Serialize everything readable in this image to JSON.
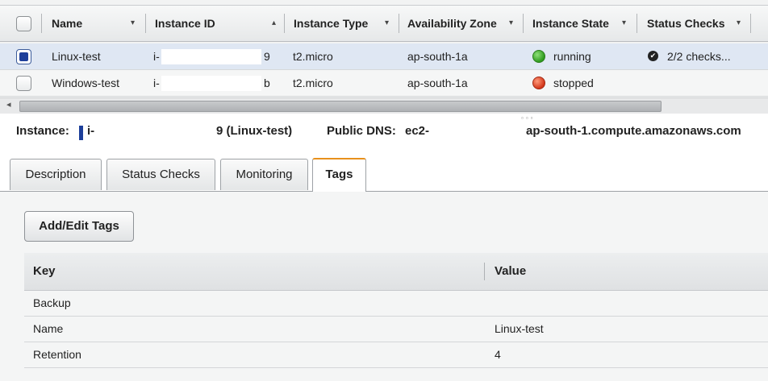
{
  "table": {
    "columns": [
      {
        "label": "Name",
        "caret": "▾"
      },
      {
        "label": "Instance ID",
        "caret": "▴"
      },
      {
        "label": "Instance Type",
        "caret": "▾"
      },
      {
        "label": "Availability Zone",
        "caret": "▾"
      },
      {
        "label": "Instance State",
        "caret": "▾"
      },
      {
        "label": "Status Checks",
        "caret": "▾"
      }
    ],
    "rows": [
      {
        "selected": true,
        "name": "Linux-test",
        "id_prefix": "i-",
        "id_suffix": "9",
        "type": "t2.micro",
        "az": "ap-south-1a",
        "state": "running",
        "state_color": "#3aa52a",
        "checks": "2/2 checks..."
      },
      {
        "selected": false,
        "name": "Windows-test",
        "id_prefix": "i-",
        "id_suffix": "b",
        "type": "t2.micro",
        "az": "ap-south-1a",
        "state": "stopped",
        "state_color": "#d9341c",
        "checks": ""
      }
    ]
  },
  "instance_info": {
    "instance_label": "Instance:",
    "instance_prefix": "i-",
    "instance_suffix": "9 (Linux-test)",
    "dns_label": "Public DNS:",
    "dns_prefix": "ec2-",
    "dns_suffix": "ap-south-1.compute.amazonaws.com"
  },
  "tabs": [
    {
      "label": "Description",
      "active": false
    },
    {
      "label": "Status Checks",
      "active": false
    },
    {
      "label": "Monitoring",
      "active": false
    },
    {
      "label": "Tags",
      "active": true
    }
  ],
  "tags": {
    "add_edit_label": "Add/Edit Tags",
    "key_header": "Key",
    "value_header": "Value",
    "rows": [
      {
        "key": "Backup",
        "value": ""
      },
      {
        "key": "Name",
        "value": "Linux-test"
      },
      {
        "key": "Retention",
        "value": "4"
      }
    ]
  },
  "colors": {
    "accent_tab": "#e8911c",
    "selected_row": "#dfe7f3",
    "running": "#3aa52a",
    "stopped": "#d9341c"
  }
}
